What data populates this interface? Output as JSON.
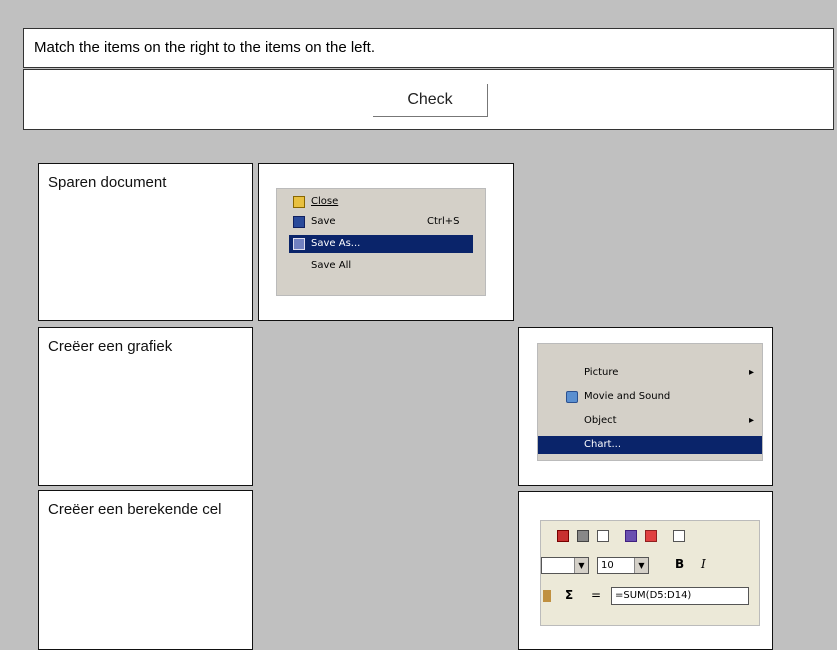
{
  "instructions": "Match the items on the right to the items on the left.",
  "check_label": "Check",
  "terms": [
    "Sparen document",
    "Creëer een grafiek",
    "Creëer een berekende cel"
  ],
  "file_menu": {
    "items": [
      {
        "label": "Close",
        "shortcut": ""
      },
      {
        "label": "Save",
        "shortcut": "Ctrl+S"
      },
      {
        "label": "Save As...",
        "shortcut": ""
      },
      {
        "label": "Save All",
        "shortcut": ""
      }
    ],
    "highlight": "Save As..."
  },
  "insert_menu": {
    "items": [
      {
        "label": "Picture",
        "arrow": "▸"
      },
      {
        "label": "Movie and Sound",
        "arrow": ""
      },
      {
        "label": "Object",
        "arrow": "▸"
      },
      {
        "label": "Chart...",
        "arrow": ""
      }
    ],
    "highlight": "Chart..."
  },
  "toolbar": {
    "font_size": "10",
    "bold": "B",
    "italic": "I",
    "sigma": "Σ",
    "equals": "=",
    "formula": "=SUM(D5:D14)"
  },
  "colors": {
    "background": "#c0c0c0",
    "highlight": "#0a246a",
    "menu_bg": "#d4d0c8"
  }
}
